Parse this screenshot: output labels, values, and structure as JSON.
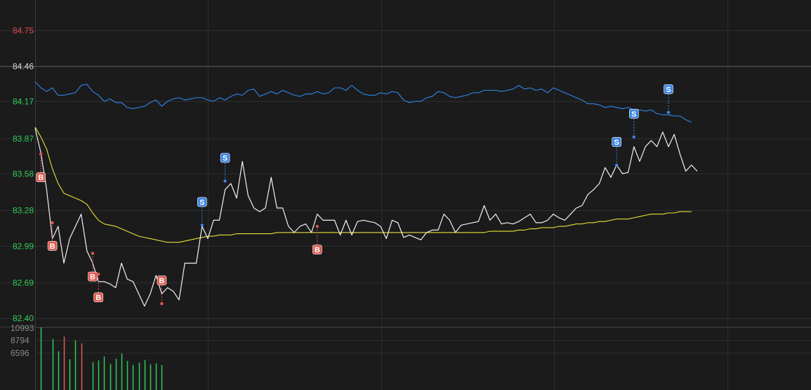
{
  "chart_data": {
    "type": "line",
    "price_panel": {
      "ylim": [
        82.4,
        84.75
      ],
      "reference_price": 84.46,
      "yticks": [
        {
          "value": 84.75,
          "label": "84.75",
          "color": "#e8474b"
        },
        {
          "value": 84.46,
          "label": "84.46",
          "color": "#d8d8d8"
        },
        {
          "value": 84.17,
          "label": "84.17",
          "color": "#2ecc55"
        },
        {
          "value": 83.87,
          "label": "83.87",
          "color": "#2ecc55"
        },
        {
          "value": 83.58,
          "label": "83.58",
          "color": "#2ecc55"
        },
        {
          "value": 83.28,
          "label": "83.28",
          "color": "#2ecc55"
        },
        {
          "value": 82.99,
          "label": "82.99",
          "color": "#2ecc55"
        },
        {
          "value": 82.69,
          "label": "82.69",
          "color": "#2ecc55"
        },
        {
          "value": 82.4,
          "label": "82.40",
          "color": "#2ecc55"
        }
      ],
      "series": [
        {
          "key": "upper",
          "color": "#2f86e8",
          "values": [
            84.33,
            84.28,
            84.25,
            84.28,
            84.22,
            84.22,
            84.23,
            84.24,
            84.3,
            84.31,
            84.25,
            84.22,
            84.17,
            84.19,
            84.16,
            84.16,
            84.12,
            84.11,
            84.12,
            84.13,
            84.16,
            84.18,
            84.13,
            84.17,
            84.19,
            84.2,
            84.18,
            84.19,
            84.2,
            84.2,
            84.18,
            84.17,
            84.2,
            84.18,
            84.21,
            84.23,
            84.22,
            84.26,
            84.27,
            84.21,
            84.23,
            84.25,
            84.23,
            84.26,
            84.24,
            84.22,
            84.21,
            84.23,
            84.23,
            84.25,
            84.23,
            84.24,
            84.28,
            84.28,
            84.26,
            84.3,
            84.26,
            84.23,
            84.22,
            84.22,
            84.24,
            84.23,
            84.25,
            84.24,
            84.18,
            84.16,
            84.17,
            84.17,
            84.2,
            84.21,
            84.25,
            84.24,
            84.21,
            84.2,
            84.21,
            84.22,
            84.24,
            84.24,
            84.26,
            84.26,
            84.26,
            84.25,
            84.26,
            84.27,
            84.3,
            84.27,
            84.28,
            84.26,
            84.27,
            84.24,
            84.28,
            84.26,
            84.24,
            84.22,
            84.2,
            84.18,
            84.15,
            84.15,
            84.14,
            84.12,
            84.13,
            84.12,
            84.11,
            84.12,
            84.1,
            84.1,
            84.09,
            84.1,
            84.07,
            84.06,
            84.06,
            84.05,
            84.05,
            84.02,
            84.0
          ]
        },
        {
          "key": "price",
          "color": "#f2f2f2",
          "values": [
            83.95,
            83.75,
            83.45,
            83.05,
            83.15,
            82.85,
            83.05,
            83.15,
            83.25,
            82.95,
            82.85,
            82.7,
            82.7,
            82.68,
            82.65,
            82.85,
            82.72,
            82.7,
            82.6,
            82.5,
            82.6,
            82.75,
            82.6,
            82.65,
            82.62,
            82.55,
            82.85,
            82.85,
            82.85,
            83.15,
            83.05,
            83.2,
            83.2,
            83.45,
            83.5,
            83.38,
            83.68,
            83.4,
            83.3,
            83.27,
            83.3,
            83.55,
            83.3,
            83.3,
            83.15,
            83.1,
            83.15,
            83.17,
            83.1,
            83.25,
            83.2,
            83.2,
            83.2,
            83.08,
            83.2,
            83.08,
            83.19,
            83.2,
            83.19,
            83.18,
            83.15,
            83.05,
            83.2,
            83.18,
            83.06,
            83.08,
            83.06,
            83.04,
            83.1,
            83.12,
            83.12,
            83.25,
            83.2,
            83.1,
            83.16,
            83.17,
            83.18,
            83.19,
            83.32,
            83.2,
            83.25,
            83.17,
            83.18,
            83.17,
            83.19,
            83.22,
            83.25,
            83.18,
            83.18,
            83.2,
            83.25,
            83.22,
            83.2,
            83.25,
            83.3,
            83.32,
            83.41,
            83.45,
            83.5,
            83.63,
            83.55,
            83.65,
            83.58,
            83.59,
            83.8,
            83.68,
            83.8,
            83.85,
            83.8,
            83.92,
            83.8,
            83.9,
            83.74,
            83.6,
            83.65,
            83.6
          ]
        },
        {
          "key": "average",
          "color": "#e6e237",
          "values": [
            83.96,
            83.88,
            83.78,
            83.62,
            83.5,
            83.42,
            83.4,
            83.38,
            83.36,
            83.33,
            83.26,
            83.2,
            83.17,
            83.16,
            83.15,
            83.13,
            83.11,
            83.09,
            83.07,
            83.06,
            83.05,
            83.04,
            83.03,
            83.02,
            83.02,
            83.02,
            83.03,
            83.04,
            83.05,
            83.06,
            83.07,
            83.07,
            83.08,
            83.08,
            83.08,
            83.09,
            83.09,
            83.09,
            83.09,
            83.09,
            83.09,
            83.09,
            83.1,
            83.1,
            83.1,
            83.1,
            83.1,
            83.1,
            83.1,
            83.1,
            83.1,
            83.1,
            83.1,
            83.1,
            83.1,
            83.1,
            83.1,
            83.1,
            83.1,
            83.1,
            83.1,
            83.1,
            83.1,
            83.1,
            83.1,
            83.1,
            83.1,
            83.1,
            83.1,
            83.1,
            83.1,
            83.1,
            83.1,
            83.1,
            83.1,
            83.1,
            83.1,
            83.1,
            83.1,
            83.11,
            83.11,
            83.11,
            83.11,
            83.11,
            83.12,
            83.12,
            83.13,
            83.13,
            83.14,
            83.14,
            83.14,
            83.15,
            83.15,
            83.16,
            83.17,
            83.17,
            83.18,
            83.18,
            83.19,
            83.19,
            83.2,
            83.21,
            83.21,
            83.21,
            83.22,
            83.23,
            83.24,
            83.25,
            83.25,
            83.25,
            83.26,
            83.26,
            83.27,
            83.27,
            83.27
          ]
        }
      ],
      "markers": [
        {
          "type": "B",
          "index": 1,
          "point": 83.74,
          "badge_offset": 1
        },
        {
          "type": "B",
          "index": 3,
          "point": 83.18,
          "badge_offset": 1
        },
        {
          "type": "B",
          "index": 10,
          "point": 82.93,
          "badge_offset": 1
        },
        {
          "type": "B",
          "index": 11,
          "point": 82.76,
          "badge_offset": 1
        },
        {
          "type": "B",
          "index": 22,
          "point": 82.52,
          "badge_offset": -1
        },
        {
          "type": "B",
          "index": 49,
          "point": 83.15,
          "badge_offset": 1
        },
        {
          "type": "S",
          "index": 29,
          "point": 83.16,
          "badge_offset": -1
        },
        {
          "type": "S",
          "index": 33,
          "point": 83.52,
          "badge_offset": -1
        },
        {
          "type": "S",
          "index": 101,
          "point": 83.65,
          "badge_offset": -1
        },
        {
          "type": "S",
          "index": 104,
          "point": 83.88,
          "badge_offset": -1
        },
        {
          "type": "S",
          "index": 110,
          "point": 84.08,
          "badge_offset": -1
        }
      ],
      "buy_color": "#e05a4f",
      "sell_color": "#3c86e6"
    },
    "volume_panel": {
      "yticks": [
        {
          "value": 10993,
          "label": "10993"
        },
        {
          "value": 8794,
          "label": "8794"
        },
        {
          "value": 6596,
          "label": "6596"
        }
      ],
      "bars": [
        {
          "index": 1,
          "value": 10990,
          "color": "#2ecc55"
        },
        {
          "index": 3,
          "value": 8950,
          "color": "#2ecc55"
        },
        {
          "index": 4,
          "value": 6800,
          "color": "#2ecc55"
        },
        {
          "index": 5,
          "value": 9400,
          "color": "#e05a4f"
        },
        {
          "index": 6,
          "value": 5400,
          "color": "#2ecc55"
        },
        {
          "index": 7,
          "value": 8700,
          "color": "#2ecc55"
        },
        {
          "index": 8,
          "value": 8200,
          "color": "#e05a4f"
        },
        {
          "index": 10,
          "value": 4900,
          "color": "#2ecc55"
        },
        {
          "index": 11,
          "value": 5200,
          "color": "#2ecc55"
        },
        {
          "index": 12,
          "value": 5900,
          "color": "#2ecc55"
        },
        {
          "index": 13,
          "value": 4600,
          "color": "#2ecc55"
        },
        {
          "index": 14,
          "value": 5500,
          "color": "#2ecc55"
        },
        {
          "index": 15,
          "value": 6400,
          "color": "#2ecc55"
        },
        {
          "index": 16,
          "value": 5100,
          "color": "#2ecc55"
        },
        {
          "index": 17,
          "value": 4400,
          "color": "#2ecc55"
        },
        {
          "index": 18,
          "value": 4800,
          "color": "#2ecc55"
        },
        {
          "index": 19,
          "value": 5300,
          "color": "#2ecc55"
        },
        {
          "index": 20,
          "value": 4500,
          "color": "#2ecc55"
        },
        {
          "index": 21,
          "value": 4700,
          "color": "#2ecc55"
        },
        {
          "index": 22,
          "value": 4400,
          "color": "#2ecc55"
        }
      ],
      "tick_color": "#8a8a8a"
    },
    "grid": true,
    "colors": {
      "background": "#1b1b1c",
      "grid": "#2d2d2e",
      "reference_line": "#4a4a4a"
    }
  }
}
